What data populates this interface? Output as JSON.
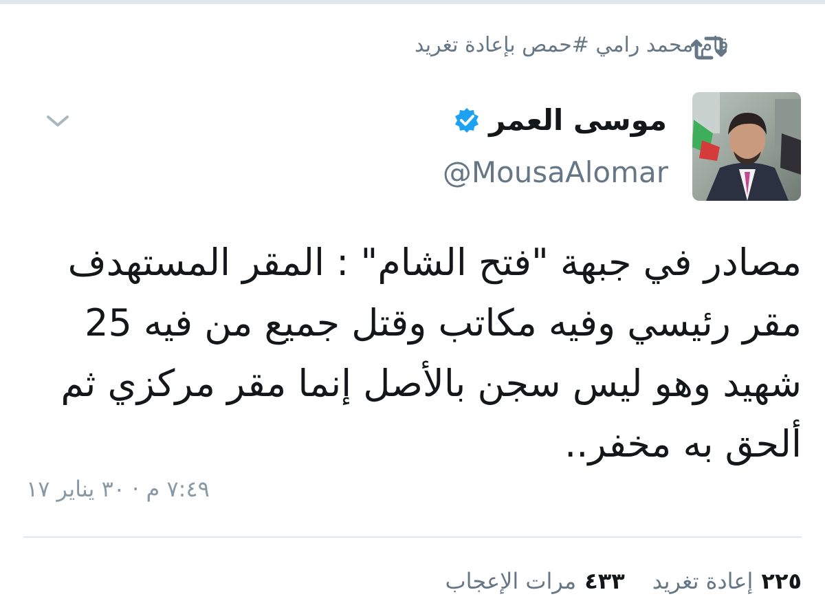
{
  "retweet_context": {
    "text": "قام محمد رامي #حمص بإعادة تغريد",
    "icon": "retweet-icon"
  },
  "tweet": {
    "author": {
      "display_name": "موسى العمر",
      "handle": "@MousaAlomar",
      "verified": true
    },
    "text": "مصادر في جبهة \"فتح الشام\" : المقر المستهدف مقر رئيسي وفيه مكاتب وقتل جميع من فيه 25 شهيد وهو ليس سجن بالأصل إنما مقر مركزي ثم ألحق به مخفر..",
    "timestamp": "٧:٤٩ م · ٣٠ يناير ١٧"
  },
  "stats": {
    "retweets_count": "٢٢٥",
    "retweets_label": "إعادة تغريد",
    "likes_count": "٤٣٣",
    "likes_label": "مرات الإعجاب"
  },
  "colors": {
    "text_primary": "#14171a",
    "text_secondary": "#657786",
    "verified_blue": "#1da1f2",
    "divider": "#e1e8ed"
  }
}
